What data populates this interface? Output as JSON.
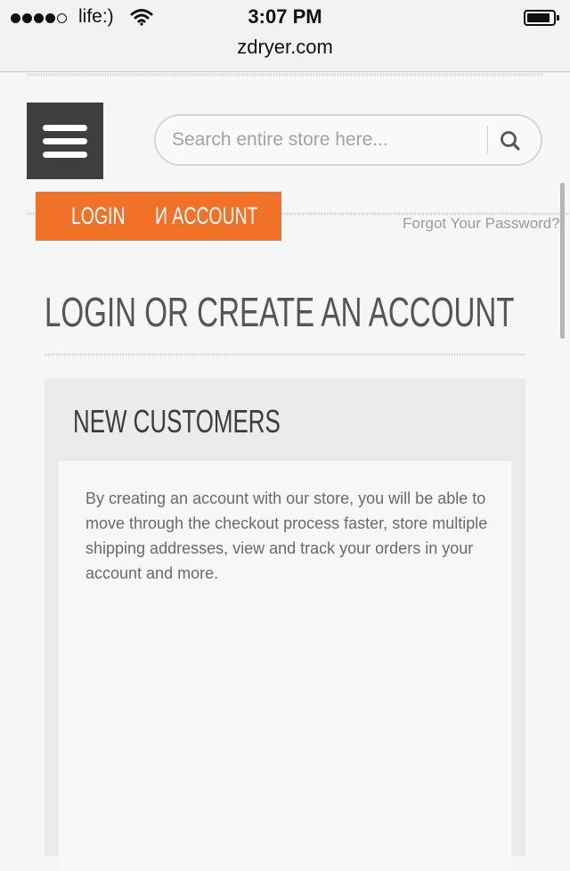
{
  "status_bar": {
    "carrier": "life:)",
    "time": "3:07 PM",
    "url": "zdryer.com",
    "icons": [
      "signal-dots-icon",
      "wifi-icon",
      "battery-icon"
    ]
  },
  "header": {
    "menu_icon": "hamburger-menu-icon",
    "search": {
      "placeholder": "Search entire store here...",
      "value": "",
      "icon": "search-icon"
    }
  },
  "account_banner": {
    "login_label": "LOGIN",
    "account_label": "И ACCOUNT"
  },
  "forgot_password": "Forgot Your Password?",
  "page_title": "LOGIN OR CREATE AN ACCOUNT",
  "new_customers": {
    "heading": "NEW CUSTOMERS",
    "text": "By creating an account with our store, you will be able to move through the checkout process faster, store multiple shipping addresses, view and track your orders in your account and more."
  },
  "colors": {
    "accent": "#f07127",
    "menu_bg": "#3e3e3e",
    "page_bg": "#f5f6f6",
    "panel_bg": "#ebebeb"
  }
}
